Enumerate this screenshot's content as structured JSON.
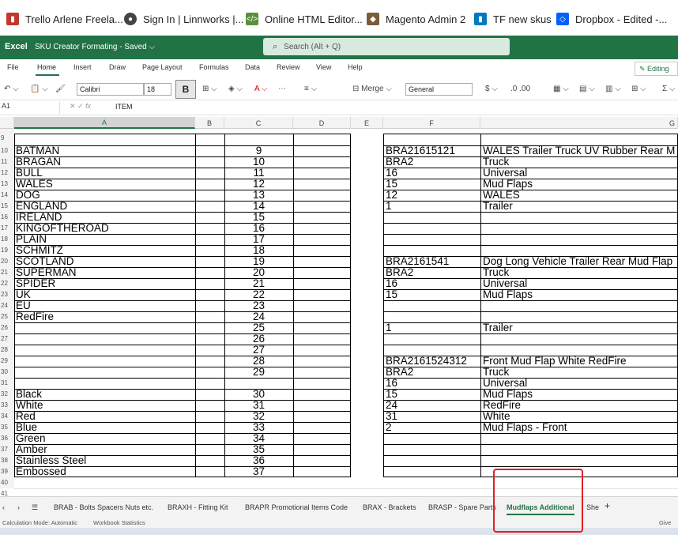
{
  "browser_bookmarks": [
    {
      "label": "Trello Arlene Freela...",
      "icon": "trello-icon",
      "color": "#c0392b"
    },
    {
      "label": "Sign In | Linnworks |...",
      "icon": "linnworks-icon",
      "color": "#444444"
    },
    {
      "label": "Online HTML Editor...",
      "icon": "html-editor-icon",
      "color": "#5a8f3c"
    },
    {
      "label": "Magento Admin 2",
      "icon": "magento-icon",
      "color": "#7a5c3a"
    },
    {
      "label": "TF new skus",
      "icon": "trello-icon",
      "color": "#0079bf"
    },
    {
      "label": "Dropbox - Edited -...",
      "icon": "dropbox-icon",
      "color": "#0061fe"
    }
  ],
  "titlebar": {
    "app": "Excel",
    "file": "SKU Creator Formating",
    "status": "Saved",
    "search_placeholder": "Search (Alt + Q)",
    "color": "#217346"
  },
  "menu": [
    "File",
    "Home",
    "Insert",
    "Draw",
    "Page Layout",
    "Formulas",
    "Data",
    "Review",
    "View",
    "Help"
  ],
  "editing_label": "Editing",
  "ribbon": {
    "font": "Calibri",
    "size": "18",
    "bold": "B",
    "merge": "Merge",
    "number_format": "General",
    "currency": "$"
  },
  "formula_bar": {
    "cell": "A1",
    "fx": "fx",
    "value": "ITEM"
  },
  "columns": [
    "A",
    "B",
    "C",
    "D",
    "E",
    "F",
    "G"
  ],
  "rows": [
    "9",
    "10",
    "11",
    "12",
    "13",
    "14",
    "15",
    "16",
    "17",
    "18",
    "19",
    "20",
    "21",
    "22",
    "23",
    "24",
    "25",
    "26",
    "27",
    "28",
    "29",
    "30",
    "31",
    "32",
    "33",
    "34",
    "35",
    "36",
    "37",
    "38",
    "39",
    "40",
    "41"
  ],
  "col_a": [
    "",
    "BATMAN",
    "BRAGAN",
    "BULL",
    "WALES",
    "DOG",
    "ENGLAND",
    "IRELAND",
    "KINGOFTHEROAD",
    "PLAIN",
    "SCHMITZ",
    "SCOTLAND",
    "SUPERMAN",
    "SPIDER",
    "UK",
    "EU",
    "RedFire",
    "",
    "",
    "",
    "",
    "",
    "",
    "Black",
    "White",
    "Red",
    "Blue",
    "Green",
    "Amber",
    "Stainless Steel",
    "Embossed",
    "",
    ""
  ],
  "col_c": [
    "",
    "9",
    "10",
    "11",
    "12",
    "13",
    "14",
    "15",
    "16",
    "17",
    "18",
    "19",
    "20",
    "21",
    "22",
    "23",
    "24",
    "25",
    "26",
    "27",
    "28",
    "29",
    "",
    "30",
    "31",
    "32",
    "33",
    "34",
    "35",
    "36",
    "37",
    "",
    ""
  ],
  "col_f": [
    "",
    "BRA21615121",
    "BRA2",
    "16",
    "15",
    "12",
    "1",
    "",
    "",
    "",
    "",
    "BRA2161541",
    "BRA2",
    "16",
    "15",
    "",
    "",
    "1",
    "",
    "",
    "BRA2161524312",
    "BRA2",
    "16",
    "15",
    "24",
    "31",
    "2",
    "",
    "",
    "",
    "",
    "",
    ""
  ],
  "col_g": [
    "",
    "WALES Trailer Truck UV Rubber Rear M",
    "Truck",
    "Universal",
    "Mud Flaps",
    "WALES",
    "Trailer",
    "",
    "",
    "",
    "",
    "Dog Long Vehicle Trailer Rear Mud Flap",
    "Truck",
    "Universal",
    "Mud Flaps",
    "",
    "",
    "Trailer",
    "",
    "",
    "Front Mud Flap White RedFire",
    "Truck",
    "Universal",
    "Mud Flaps",
    "RedFire",
    "White",
    "Mud Flaps - Front",
    "",
    "",
    "",
    "",
    "",
    ""
  ],
  "sheet_tabs": [
    "BRAB - Bolts Spacers Nuts etc.",
    "BRAXH - Fitting Kit",
    "BRAPR Promotional Items Code",
    "BRAX - Brackets",
    "BRASP - Spare Parts",
    "Mudflaps Additional",
    "She"
  ],
  "active_tab": "Mudflaps Additional",
  "status": {
    "calc": "Calculation Mode: Automatic",
    "stats": "Workbook Statistics",
    "feedback": "Give Fe"
  },
  "highlight_color": "#e0202a"
}
